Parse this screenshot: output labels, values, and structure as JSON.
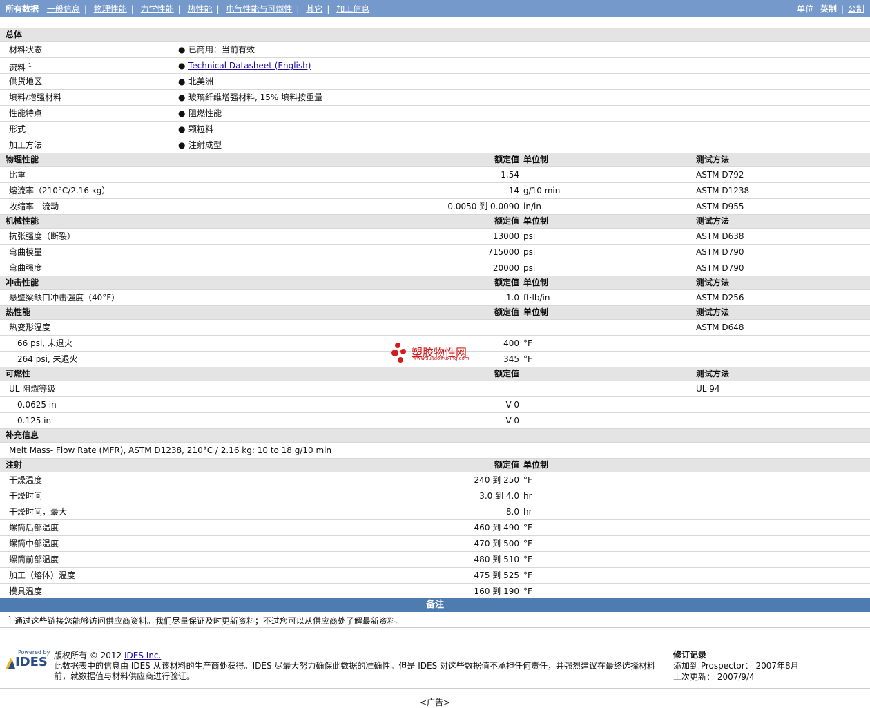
{
  "nav": {
    "all_data": "所有数据",
    "tabs": [
      "一般信息",
      "物理性能",
      "力学性能",
      "热性能",
      "电气性能与可燃性",
      "其它",
      "加工信息"
    ],
    "unit_label": "单位",
    "unit_english": "英制",
    "unit_metric": "公制"
  },
  "general": {
    "title": "总体",
    "rows": [
      {
        "label": "材料状态",
        "value": "已商用：当前有效"
      },
      {
        "label": "资料",
        "sup": "1",
        "value": "Technical Datasheet (English)",
        "link": true
      },
      {
        "label": "供货地区",
        "value": "北美洲"
      },
      {
        "label": "填料/增强材料",
        "value": "玻璃纤维增强材料, 15% 填料按重量"
      },
      {
        "label": "性能特点",
        "value": "阻燃性能"
      },
      {
        "label": "形式",
        "value": "颗粒料"
      },
      {
        "label": "加工方法",
        "value": "注射成型"
      }
    ]
  },
  "headers": {
    "nominal": "额定值",
    "unit": "单位制",
    "test": "测试方法"
  },
  "physical": {
    "title": "物理性能",
    "rows": [
      {
        "label": "比重",
        "value": "1.54",
        "unit": "",
        "test": "ASTM D792"
      },
      {
        "label": "熔流率（210°C/2.16 kg）",
        "value": "14",
        "unit": "g/10 min",
        "test": "ASTM D1238"
      },
      {
        "label": "收缩率 - 流动",
        "value": "0.0050 到  0.0090",
        "unit": "in/in",
        "test": "ASTM D955"
      }
    ]
  },
  "mechanical": {
    "title": "机械性能",
    "rows": [
      {
        "label": "抗张强度（断裂）",
        "value": "13000",
        "unit": "psi",
        "test": "ASTM D638"
      },
      {
        "label": "弯曲模量",
        "value": "715000",
        "unit": "psi",
        "test": "ASTM D790"
      },
      {
        "label": "弯曲强度",
        "value": "20000",
        "unit": "psi",
        "test": "ASTM D790"
      }
    ]
  },
  "impact": {
    "title": "冲击性能",
    "rows": [
      {
        "label": "悬壁梁缺口冲击强度（40°F）",
        "value": "1.0",
        "unit": "ft·lb/in",
        "test": "ASTM D256"
      }
    ]
  },
  "thermal": {
    "title": "热性能",
    "rows": [
      {
        "label": "热变形温度",
        "value": "",
        "unit": "",
        "test": "ASTM D648"
      },
      {
        "label": "66 psi, 未退火",
        "value": "400",
        "unit": "°F",
        "test": "",
        "sub": true
      },
      {
        "label": "264 psi, 未退火",
        "value": "345",
        "unit": "°F",
        "test": "",
        "sub": true
      }
    ]
  },
  "flammability": {
    "title": "可燃性",
    "rows": [
      {
        "label": "UL 阻燃等级",
        "value": "",
        "test": "UL 94"
      },
      {
        "label": "0.0625 in",
        "value": "V-0",
        "test": "",
        "sub": true
      },
      {
        "label": "0.125 in",
        "value": "V-0",
        "test": "",
        "sub": true
      }
    ]
  },
  "supplement": {
    "title": "补充信息",
    "text": "Melt Mass- Flow Rate (MFR), ASTM D1238, 210°C / 2.16 kg: 10 to 18 g/10 min"
  },
  "injection": {
    "title": "注射",
    "rows": [
      {
        "label": "干燥温度",
        "value": "240 到  250",
        "unit": "°F"
      },
      {
        "label": "干燥时间",
        "value": "3.0 到  4.0",
        "unit": "hr"
      },
      {
        "label": "干燥时间，最大",
        "value": "8.0",
        "unit": "hr"
      },
      {
        "label": "螺筒后部温度",
        "value": "460 到  490",
        "unit": "°F"
      },
      {
        "label": "螺筒中部温度",
        "value": "470 到  500",
        "unit": "°F"
      },
      {
        "label": "螺筒前部温度",
        "value": "480 到  510",
        "unit": "°F"
      },
      {
        "label": "加工（熔体）温度",
        "value": "475 到  525",
        "unit": "°F"
      },
      {
        "label": "模具温度",
        "value": "160 到  190",
        "unit": "°F"
      }
    ]
  },
  "notes": {
    "title": "备注",
    "sup": "1",
    "text": "通过这些链接您能够访问供应商资料。我们尽量保证及时更新资料；不过您可以从供应商处了解最新资料。"
  },
  "footer": {
    "logo_powered": "Powered by",
    "logo_name": "IDES",
    "copyright_prefix": "版权所有  © 2012 ",
    "copyright_link": "IDES Inc.",
    "disclaimer": "此数据表中的信息由  IDES 从该材料的生产商处获得。IDES 尽最大努力确保此数据的准确性。但是  IDES 对这些数据值不承担任何责任，并强烈建议在最终选择材料前，就数据值与材料供应商进行验证。",
    "revision_title": "修订记录",
    "added_label": "添加到  Prospector：",
    "added_value": "2007年8月",
    "updated_label": "上次更新：",
    "updated_value": "2007/9/4",
    "ad": "<广告>"
  },
  "watermark": {
    "text": "塑胶物性网",
    "url": "www.sujiaowuxing.com"
  },
  "colors": {
    "nav_bg": "#7699cc",
    "section_bg": "#e4e4e4",
    "notes_bg": "#4e7bb0",
    "watermark": "#d51c1c"
  }
}
